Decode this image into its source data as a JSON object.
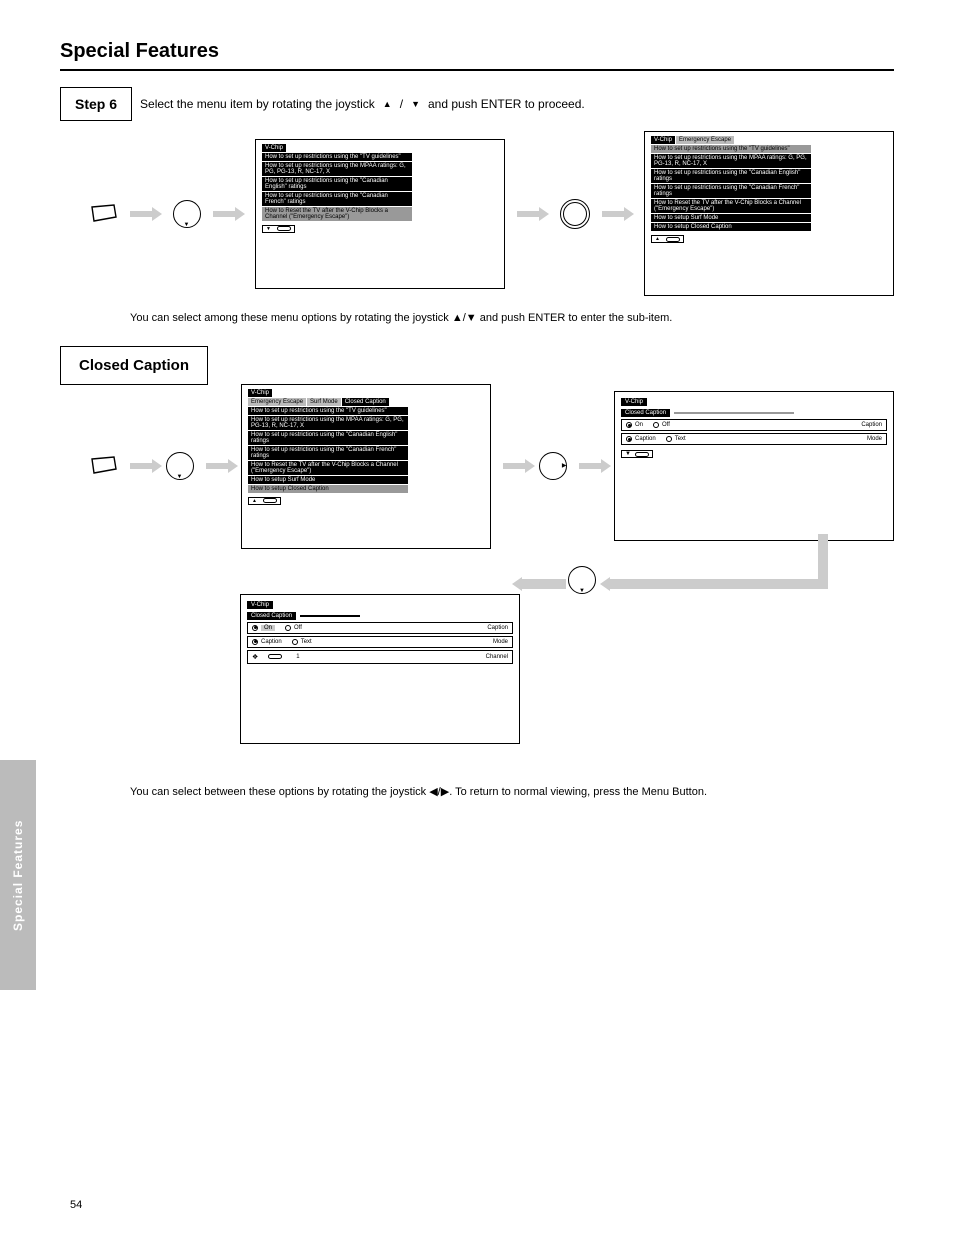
{
  "header": {
    "title": "Special Features"
  },
  "step6": {
    "label": "Step 6",
    "instruction_before": "Select the menu item by rotating the joystick",
    "instruction_after": "and push ENTER to proceed.",
    "tri_up": "▲",
    "tri_down": "▼",
    "screen1": {
      "tab": "V-Chip",
      "items": [
        "How to set up restrictions using the \"TV guidelines\"",
        "How to set up restrictions using the MPAA ratings: G, PG, PG-13, R, NC-17, X",
        "How to set up restrictions using the \"Canadian English\" ratings",
        "How to set up restrictions using the \"Canadian French\" ratings",
        "How to Reset the TV after the V-Chip Blocks a Channel (\"Emergency Escape\")"
      ],
      "item_selected": 4,
      "pager": "▼"
    },
    "screen2": {
      "tab": "V-Chip",
      "subtab": "Emergency Escape",
      "items": [
        "How to set up restrictions using the \"TV guidelines\"",
        "How to set up restrictions using the MPAA ratings: G, PG, PG-13, R, NC-17, X",
        "How to set up restrictions using the \"Canadian English\" ratings",
        "How to set up restrictions using the \"Canadian French\" ratings",
        "How to Reset the TV after the V-Chip Blocks a Channel (\"Emergency Escape\")",
        "How to setup Surf Mode",
        "How to setup Closed Caption"
      ],
      "pager": "▲"
    },
    "note": "You can select among these menu options by rotating the joystick ▲/▼ and push ENTER to enter the sub-item."
  },
  "closedcaption": {
    "box": "Closed Caption",
    "screen1": {
      "tab": "V-Chip",
      "subtab_row": [
        "Emergency Escape",
        "Surf Mode",
        "Closed Caption"
      ],
      "items": [
        "How to set up restrictions using the \"TV guidelines\"",
        "How to set up restrictions using the MPAA ratings: G, PG, PG-13, R, NC-17, X",
        "How to set up restrictions using the \"Canadian English\" ratings",
        "How to set up restrictions using the \"Canadian French\" ratings",
        "How to Reset the TV after the V-Chip Blocks a Channel (\"Emergency Escape\")",
        "How to setup Surf Mode",
        "How to setup Closed Caption"
      ],
      "item_selected": 6,
      "pager": "▲"
    },
    "screen2": {
      "tab": "V-Chip",
      "title_row": [
        "Closed Caption",
        ""
      ],
      "row1": {
        "label": "Caption",
        "opts": [
          "On",
          "Off"
        ],
        "sel": 0
      },
      "row2": {
        "label": "Mode",
        "opts": [
          "Caption",
          "Text"
        ],
        "sel": 0
      },
      "pager": "▼"
    },
    "screen3": {
      "tab": "V-Chip",
      "title_row": [
        "Closed Caption"
      ],
      "row1": {
        "label": "Caption",
        "opts": [
          "On",
          "Off"
        ],
        "sel_hl": true,
        "sel": 0
      },
      "row2": {
        "label": "Mode",
        "opts": [
          "Caption",
          "Text"
        ],
        "sel": 0
      },
      "row3": {
        "label": "Channel",
        "val": "1"
      },
      "pager_sym": "❖"
    },
    "note": "You can select between these options by rotating the joystick ◀/▶. To return to normal viewing, press the Menu Button."
  },
  "sidebar": "Special Features",
  "page_number": "54"
}
